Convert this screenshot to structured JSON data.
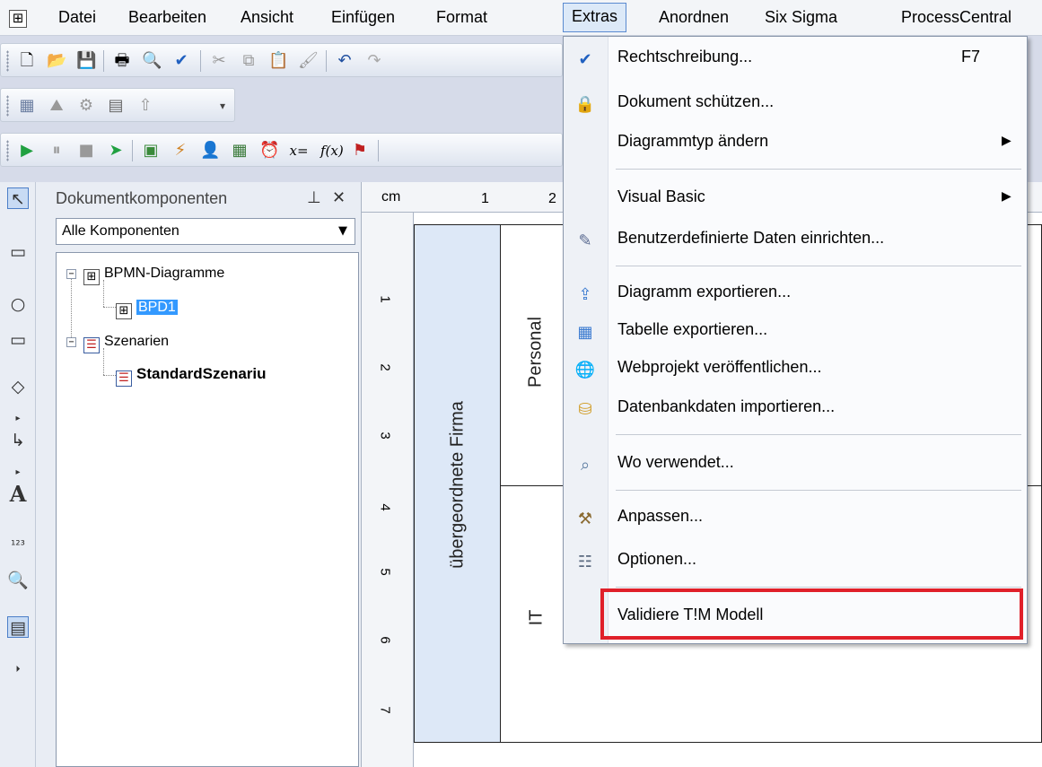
{
  "menubar": {
    "items": [
      "Datei",
      "Bearbeiten",
      "Ansicht",
      "Einfügen",
      "Format",
      "Extras",
      "Anordnen",
      "Six Sigma",
      "ProcessCentral"
    ],
    "active": "Extras"
  },
  "panel": {
    "title": "Dokumentkomponenten",
    "pin": "⊥",
    "close": "✕",
    "filter_value": "Alle Komponenten",
    "tree": {
      "bpmn": "BPMN-Diagramme",
      "bpd": "BPD1",
      "scenarios": "Szenarien",
      "standard": "StandardSzenariu"
    }
  },
  "canvas": {
    "ruler_unit": "cm",
    "ruler_top": [
      "1",
      "2"
    ],
    "ruler_left": [
      "1",
      "2",
      "3",
      "4",
      "5",
      "6",
      "7"
    ],
    "pool_label": "übergeordnete Firma",
    "lanes": [
      "Personal",
      "IT"
    ]
  },
  "extras_menu": {
    "items": [
      {
        "label": "Rechtschreibung...",
        "shortcut": "F7",
        "icon": "spellcheck-icon"
      },
      {
        "label": "Dokument schützen...",
        "icon": "lock-icon"
      },
      {
        "label": "Diagrammtyp ändern",
        "submenu": true
      },
      {
        "label": "Visual Basic",
        "submenu": true
      },
      {
        "label": "Benutzerdefinierte Daten einrichten...",
        "icon": "custom-data-icon"
      },
      {
        "label": "Diagramm exportieren...",
        "icon": "export-diagram-icon"
      },
      {
        "label": "Tabelle exportieren...",
        "icon": "export-table-icon"
      },
      {
        "label": "Webprojekt veröffentlichen...",
        "icon": "publish-web-icon"
      },
      {
        "label": "Datenbankdaten importieren...",
        "icon": "database-import-icon"
      },
      {
        "label": "Wo verwendet...",
        "icon": "where-used-icon"
      },
      {
        "label": "Anpassen...",
        "icon": "customize-icon"
      },
      {
        "label": "Optionen...",
        "icon": "options-icon"
      },
      {
        "label": "Validiere T!M Modell"
      }
    ]
  }
}
